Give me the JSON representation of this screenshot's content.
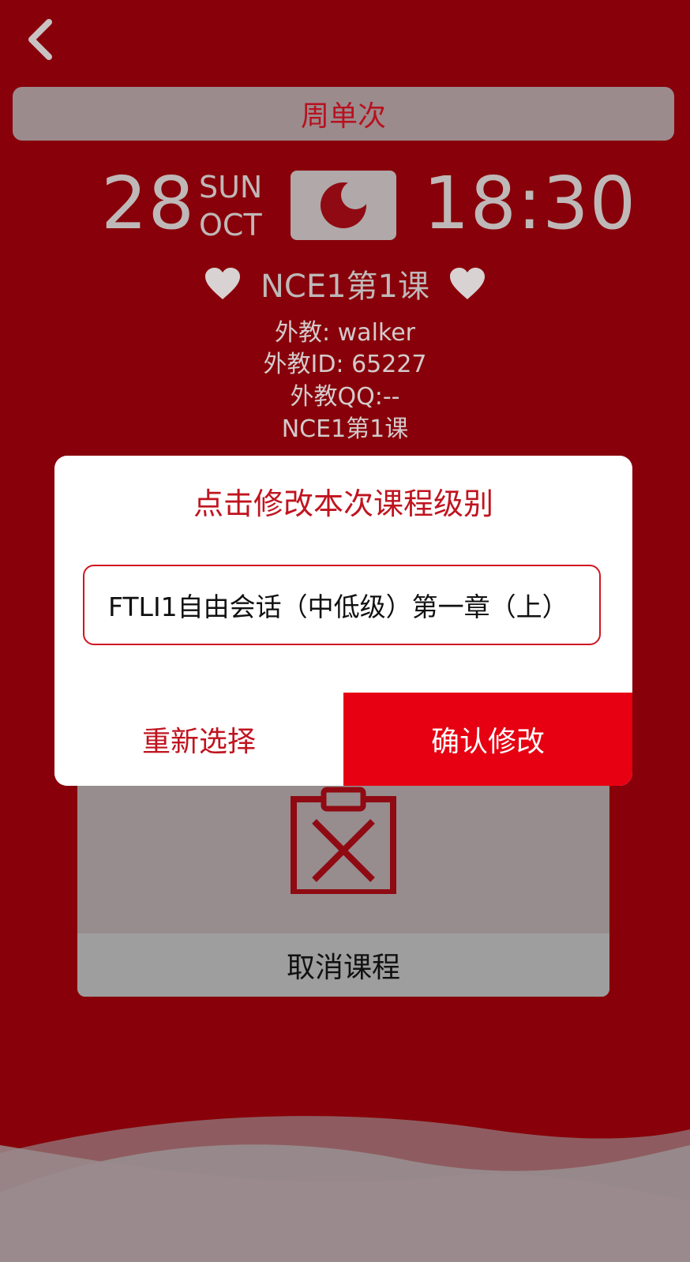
{
  "header": {
    "back_icon": "chevron-left-icon"
  },
  "schedule_type": "周单次",
  "date": {
    "day": "28",
    "weekday": "SUN",
    "month": "OCT",
    "period_icon": "moon-icon",
    "time": "18:30"
  },
  "course": {
    "title": "NCE1第1课",
    "heart_icon": "heart-icon",
    "teacher": "外教: walker",
    "teacher_id": "外教ID: 65227",
    "teacher_qq": "外教QQ:--",
    "lesson": "NCE1第1课"
  },
  "dialog": {
    "title": "点击修改本次课程级别",
    "level_value": "FTLI1自由会话（中低级）第一章（上）",
    "reselect_label": "重新选择",
    "confirm_label": "确认修改"
  },
  "cancel": {
    "icon": "clipboard-x-icon",
    "label": "取消课程"
  },
  "colors": {
    "background": "#880009",
    "accent": "#e60012",
    "text_red": "#c0141f"
  }
}
